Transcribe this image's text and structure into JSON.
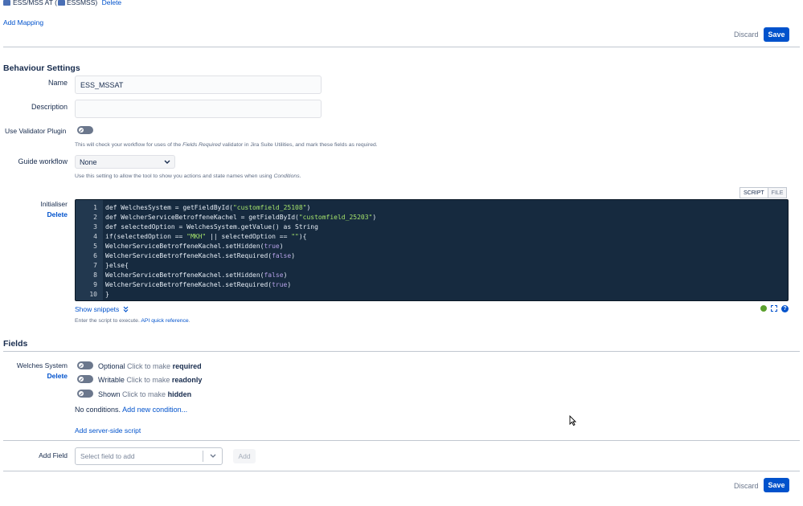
{
  "header": {
    "mapping_text": "ESS/MSS AT (",
    "mapping_key": "ESSMSS)",
    "delete_label": "Delete",
    "add_mapping": "Add Mapping"
  },
  "actions": {
    "discard": "Discard",
    "save": "Save"
  },
  "behaviour": {
    "title": "Behaviour Settings",
    "name_label": "Name",
    "name_value": "ESS_MSSAT",
    "description_label": "Description",
    "description_value": "",
    "validator_label": "Use Validator Plugin",
    "validator_help_1": "This will check your workflow for uses of the ",
    "validator_help_em": "Fields Required",
    "validator_help_2": " validator in Jira Suite Utilities, and mark these fields as required.",
    "guide_label": "Guide workflow",
    "guide_value": "None",
    "guide_help_1": "Use this setting to allow the tool to show you actions and state names when using ",
    "guide_help_em": "Conditions",
    "guide_help_2": "."
  },
  "initialiser": {
    "label": "Initialiser",
    "delete_label": "Delete",
    "tab_script": "SCRIPT",
    "tab_file": "FILE",
    "code": [
      {
        "n": "1",
        "parts": [
          {
            "t": "def WelchesSystem = getFieldById(",
            "c": ""
          },
          {
            "t": "\"customfield_25108\"",
            "c": "str"
          },
          {
            "t": ")",
            "c": ""
          }
        ]
      },
      {
        "n": "2",
        "parts": [
          {
            "t": "def WelcherServiceBetroffeneKachel = getFieldById(",
            "c": ""
          },
          {
            "t": "\"customfield_25203\"",
            "c": "str"
          },
          {
            "t": ")",
            "c": ""
          }
        ]
      },
      {
        "n": "3",
        "parts": [
          {
            "t": "def selectedOption = WelchesSystem.getValue() as String",
            "c": ""
          }
        ]
      },
      {
        "n": "4",
        "parts": [
          {
            "t": "if(selectedOption == ",
            "c": ""
          },
          {
            "t": "\"MKH\"",
            "c": "str"
          },
          {
            "t": " || selectedOption == ",
            "c": ""
          },
          {
            "t": "\"\"",
            "c": "str"
          },
          {
            "t": "){",
            "c": ""
          }
        ]
      },
      {
        "n": "5",
        "parts": [
          {
            "t": "WelcherServiceBetroffeneKachel.setHidden(",
            "c": ""
          },
          {
            "t": "true",
            "c": "kw"
          },
          {
            "t": ")",
            "c": ""
          }
        ]
      },
      {
        "n": "6",
        "parts": [
          {
            "t": "WelcherServiceBetroffeneKachel.setRequired(",
            "c": ""
          },
          {
            "t": "false",
            "c": "kw"
          },
          {
            "t": ")",
            "c": ""
          }
        ]
      },
      {
        "n": "7",
        "parts": [
          {
            "t": "}else{",
            "c": ""
          }
        ]
      },
      {
        "n": "8",
        "parts": [
          {
            "t": "WelcherServiceBetroffeneKachel.setHidden(",
            "c": ""
          },
          {
            "t": "false",
            "c": "kw"
          },
          {
            "t": ")",
            "c": ""
          }
        ]
      },
      {
        "n": "9",
        "parts": [
          {
            "t": "WelcherServiceBetroffeneKachel.setRequired(",
            "c": ""
          },
          {
            "t": "true",
            "c": "kw"
          },
          {
            "t": ")",
            "c": ""
          }
        ]
      },
      {
        "n": "10",
        "parts": [
          {
            "t": "}",
            "c": ""
          }
        ]
      }
    ],
    "show_snippets": "Show snippets",
    "help_1": "Enter the script to execute. ",
    "help_link": "API quick reference",
    "help_2": "."
  },
  "fields": {
    "title": "Fields",
    "field_name": "Welches System",
    "delete_label": "Delete",
    "rows": [
      {
        "state": "Optional",
        "hint": "Click to make",
        "target": "required"
      },
      {
        "state": "Writable",
        "hint": "Click to make",
        "target": "readonly"
      },
      {
        "state": "Shown",
        "hint": "Click to make",
        "target": "hidden"
      }
    ],
    "no_conditions": "No conditions.",
    "add_condition": "Add new condition...",
    "add_server_script": "Add server-side script"
  },
  "add_field": {
    "label": "Add Field",
    "placeholder": "Select field to add",
    "button": "Add"
  },
  "colors": {
    "primary": "#0052cc",
    "code_bg": "#162a3f",
    "string": "#a5e36b",
    "keyword": "#b4a0e5"
  }
}
